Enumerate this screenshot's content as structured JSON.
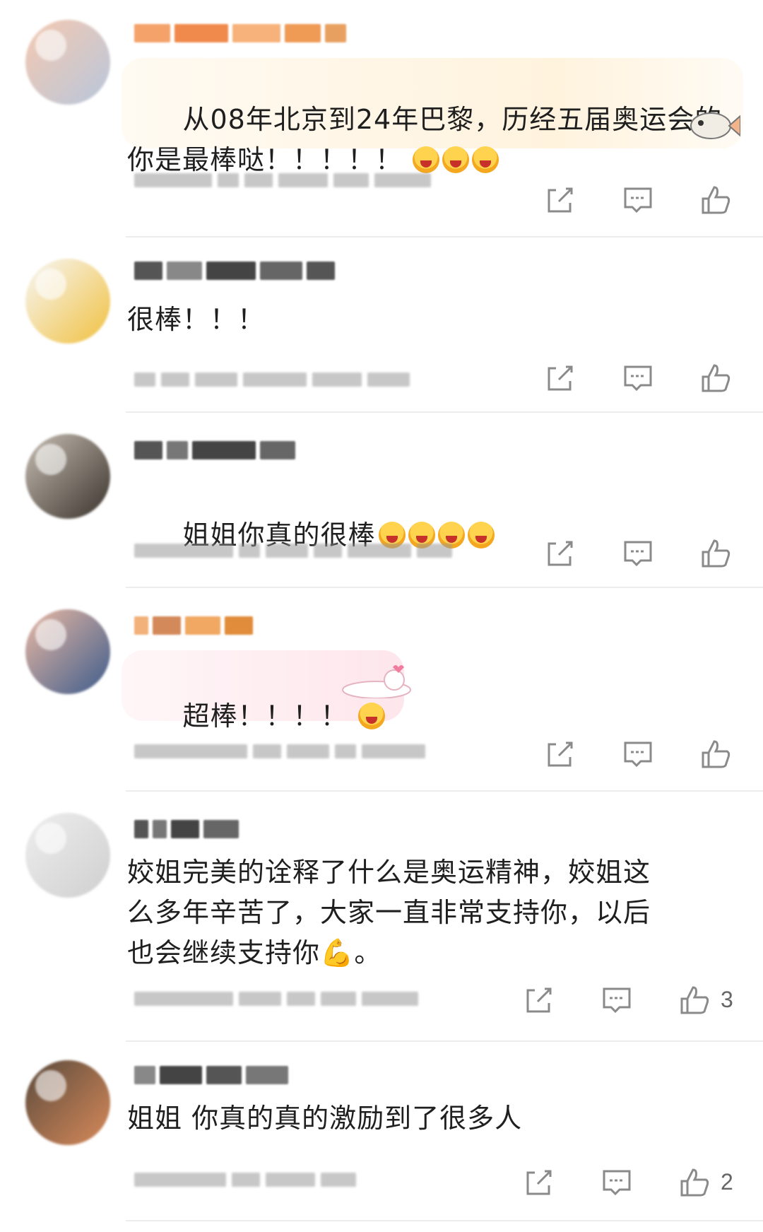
{
  "comments": [
    {
      "text": "从08年北京到24年巴黎，历经五届奥运会的\n你是最棒哒！！！！！",
      "emojis": 3,
      "like_count": "",
      "avatar_colors": [
        "#f5c9b0",
        "#c9d6e6"
      ]
    },
    {
      "text": "很棒！！！",
      "emojis": 0,
      "like_count": "",
      "avatar_colors": [
        "#f3f3f3",
        "#f1c23a"
      ]
    },
    {
      "text": "姐姐你真的很棒",
      "emojis": 4,
      "like_count": "",
      "avatar_colors": [
        "#b9b0a6",
        "#3a3530"
      ]
    },
    {
      "text": "超棒！！！！",
      "emojis": 1,
      "like_count": "",
      "avatar_colors": [
        "#e6b9a6",
        "#3e5c8c"
      ]
    },
    {
      "text": "姣姐完美的诠释了什么是奥运精神，姣姐这\n么多年辛苦了，大家一直非常支持你，以后\n也会继续支持你💪。",
      "emojis": 0,
      "like_count": "3",
      "avatar_colors": [
        "#e4e4e4",
        "#cfcfcf"
      ]
    },
    {
      "text": "姐姐 你真的真的激励到了很多人",
      "emojis": 0,
      "like_count": "2",
      "avatar_colors": [
        "#5a4a3c",
        "#d88a5a"
      ]
    }
  ],
  "icons": {
    "share": "share-icon",
    "reply": "comment-icon",
    "like": "thumbs-up-icon"
  },
  "colors": {
    "text": "#1f1f1f",
    "icon": "#8a8a8a",
    "divider": "#ececec",
    "bubble": "#fff3de"
  }
}
